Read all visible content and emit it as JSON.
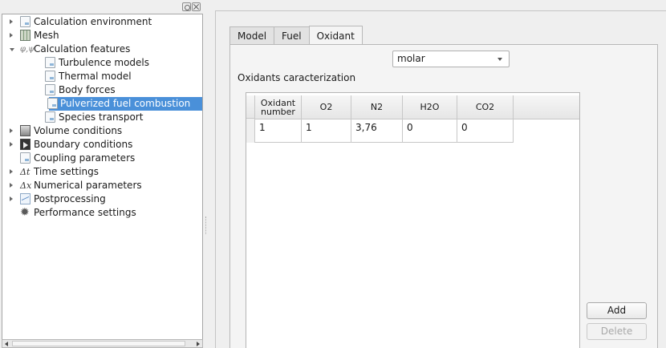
{
  "tree": {
    "items": [
      {
        "label": "Calculation environment",
        "expander": "collapsed",
        "icon": "document-icon"
      },
      {
        "label": "Mesh",
        "expander": "collapsed",
        "icon": "mesh-icon"
      },
      {
        "label": "Calculation features",
        "expander": "expanded",
        "icon": "phi-symbol-icon",
        "icon_glyph": "φ,ψ"
      },
      {
        "label": "Turbulence models",
        "expander": "none",
        "icon": "document-icon"
      },
      {
        "label": "Thermal model",
        "expander": "none",
        "icon": "document-icon"
      },
      {
        "label": "Body forces",
        "expander": "none",
        "icon": "document-icon"
      },
      {
        "label": "Pulverized fuel combustion",
        "expander": "none",
        "icon": "document-icon",
        "selected": true
      },
      {
        "label": "Species transport",
        "expander": "none",
        "icon": "document-icon"
      },
      {
        "label": "Volume conditions",
        "expander": "collapsed",
        "icon": "volume-icon"
      },
      {
        "label": "Boundary conditions",
        "expander": "collapsed",
        "icon": "boundary-icon"
      },
      {
        "label": "Coupling parameters",
        "expander": "none",
        "icon": "document-icon"
      },
      {
        "label": "Time settings",
        "expander": "collapsed",
        "icon": "delta-t-icon",
        "icon_glyph": "Δt"
      },
      {
        "label": "Numerical parameters",
        "expander": "collapsed",
        "icon": "delta-x-icon",
        "icon_glyph": "Δx"
      },
      {
        "label": "Postprocessing",
        "expander": "collapsed",
        "icon": "chart-icon"
      },
      {
        "label": "Performance settings",
        "expander": "none",
        "icon": "gear-icon",
        "icon_glyph": "✹"
      }
    ]
  },
  "tabs": [
    {
      "label": "Model",
      "active": false
    },
    {
      "label": "Fuel",
      "active": false
    },
    {
      "label": "Oxidant",
      "active": true
    }
  ],
  "oxidant": {
    "mode_select_value": "molar",
    "section_label": "Oxidants caracterization",
    "table": {
      "headers": [
        "Oxidant\nnumber",
        "O2",
        "N2",
        "H2O",
        "CO2"
      ],
      "rows": [
        [
          "1",
          "1",
          "3,76",
          "0",
          "0"
        ]
      ]
    },
    "add_label": "Add",
    "delete_label": "Delete"
  },
  "colors": {
    "selection": "#4a90d9",
    "window_bg": "#efefef"
  }
}
